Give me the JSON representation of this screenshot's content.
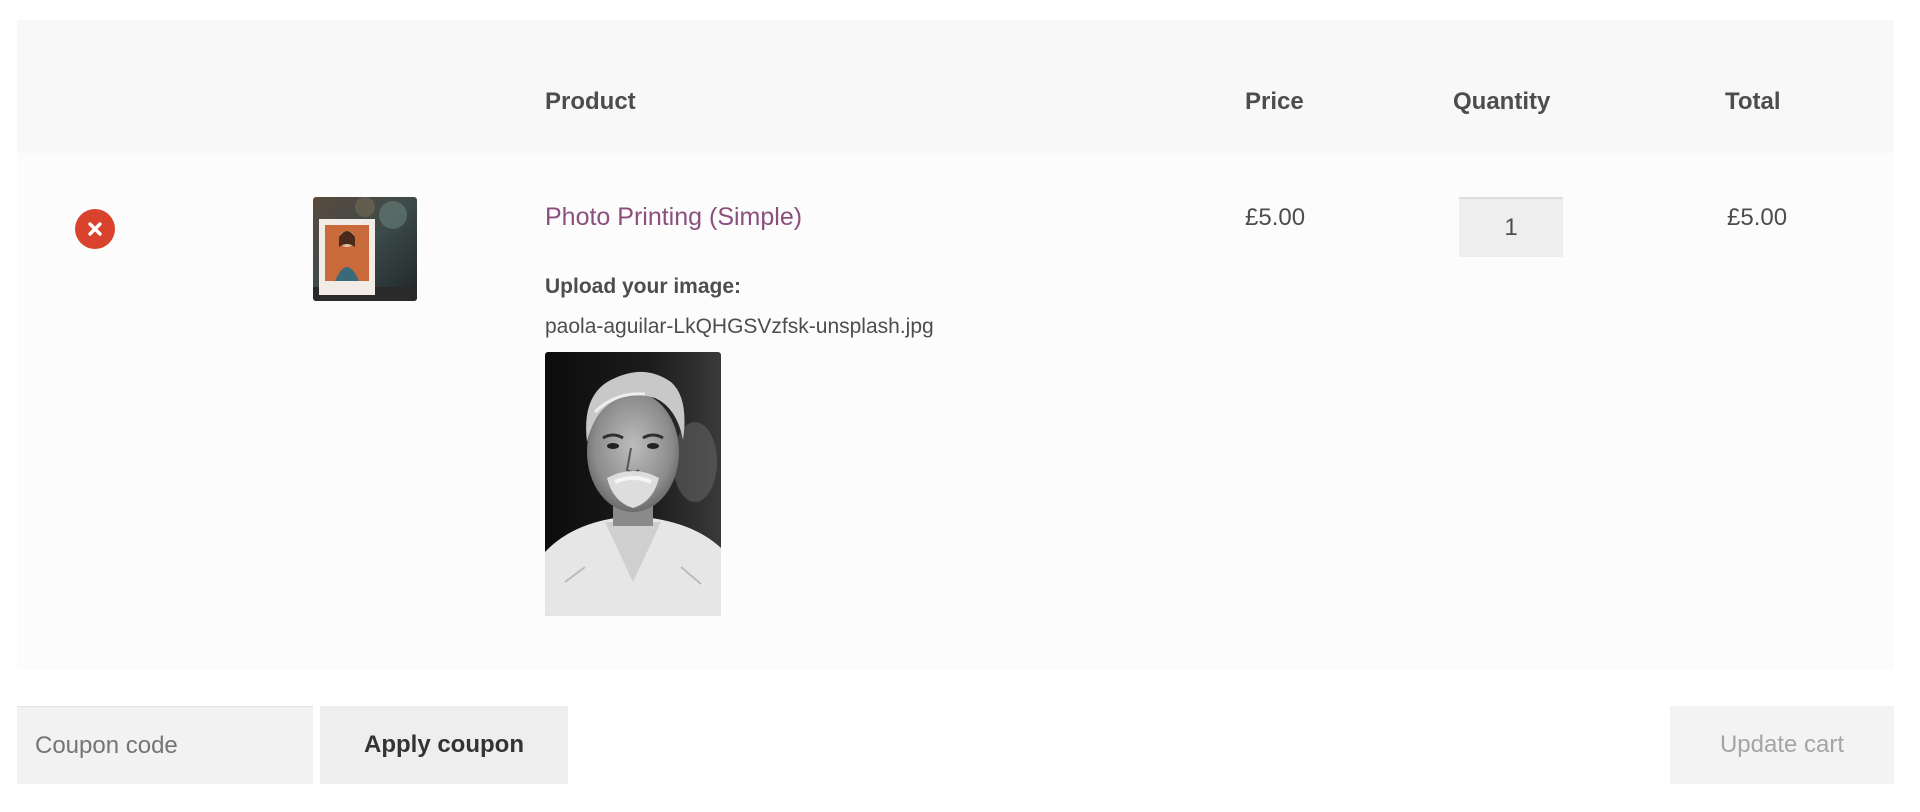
{
  "table": {
    "headers": {
      "product": "Product",
      "price": "Price",
      "quantity": "Quantity",
      "total": "Total"
    },
    "rows": [
      {
        "name": "Photo Printing (Simple)",
        "meta_label": "Upload your image:",
        "meta_value": "paola-aguilar-LkQHGSVzfsk-unsplash.jpg",
        "price": "£5.00",
        "quantity": "1",
        "total": "£5.00"
      }
    ]
  },
  "coupon": {
    "placeholder": "Coupon code",
    "apply_label": "Apply coupon"
  },
  "update_label": "Update cart",
  "colors": {
    "link": "#8b4f7e",
    "remove": "#d9432d",
    "header_bg": "#f8f8f8"
  },
  "icons": {
    "remove": "close-circle-icon"
  }
}
